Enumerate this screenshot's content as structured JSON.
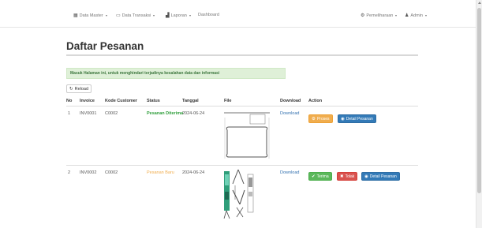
{
  "navbar": {
    "data_master": "Data Master",
    "data_transaksi": "Data Transaksi",
    "laporan": "Laporan",
    "dashboard": "Dashboard",
    "pemeliharaan": "Pemeliharaan",
    "admin": "Admin"
  },
  "page": {
    "title": "Daftar Pesanan",
    "alert": "Masuk Halaman ini, untuk menghindari terjadinya kesalahan data dan informasi",
    "reload": "Reload"
  },
  "table": {
    "headers": [
      "No",
      "Invoice",
      "Kode Customer",
      "Status",
      "Tanggal",
      "File",
      "Download",
      "Action"
    ],
    "rows": [
      {
        "no": "1",
        "invoice": "INV0001",
        "customer": "C0002",
        "status": "Pesanan Diterima",
        "tanggal": "2024-06-24",
        "download": "Download",
        "actions": [
          "Proses",
          "Detail Pesanan"
        ]
      },
      {
        "no": "2",
        "invoice": "INV0002",
        "customer": "C0002",
        "status": "Pesanan Baru",
        "tanggal": "2024-06-24",
        "download": "Download",
        "actions": [
          "Terima",
          "Tolak",
          "Detail Pesanan"
        ]
      }
    ]
  },
  "colors": {
    "success": "#5cb85c",
    "warning": "#f0ad4e",
    "danger": "#d9534f",
    "primary": "#337ab7",
    "alert_bg": "#dff0d8"
  },
  "icons": {
    "data_master": "grid-icon",
    "data_transaksi": "window-icon",
    "laporan": "bar-chart-icon",
    "pemeliharaan": "gear-icon",
    "admin": "user-icon",
    "reload": "refresh-icon",
    "proses": "gear-icon",
    "detail": "eye-icon",
    "terima": "check-circle-icon",
    "tolak": "x-circle-icon"
  }
}
